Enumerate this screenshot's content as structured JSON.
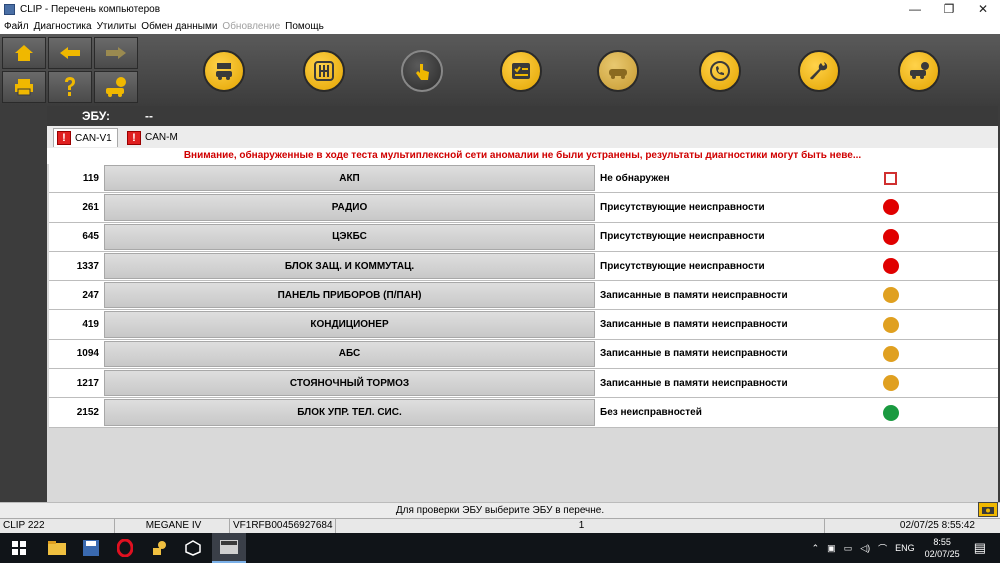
{
  "window": {
    "title": "CLIP - Перечень компьютеров",
    "minimize": "—",
    "restore": "❐",
    "close": "✕"
  },
  "menu": [
    {
      "label": "Файл",
      "disabled": false
    },
    {
      "label": "Диагностика",
      "disabled": false
    },
    {
      "label": "Утилиты",
      "disabled": false
    },
    {
      "label": "Обмен данными",
      "disabled": false
    },
    {
      "label": "Обновление",
      "disabled": true
    },
    {
      "label": "Помощь",
      "disabled": false
    }
  ],
  "toolbar": {
    "nav_icons": [
      "home-icon",
      "back-arrow-icon",
      "forward-arrow-icon",
      "print-icon",
      "help-icon",
      "vehicle-help-icon"
    ],
    "tool_icons": [
      "vehicle-id-icon",
      "gearbox-icon",
      "touch-icon",
      "checklist-icon",
      "car-diagnosis-icon",
      "phone-support-icon",
      "wrench-icon",
      "car-settings-icon"
    ]
  },
  "ecu": {
    "label": "ЭБУ:",
    "value": "--"
  },
  "tabs": [
    {
      "label": "CAN-V1",
      "flag": "!"
    },
    {
      "label": "CAN-M",
      "flag": "!"
    }
  ],
  "warning": "Внимание, обнаруженные в ходе теста мультиплексной сети аномалии не были устранены, результаты диагностики могут быть неве...",
  "rows": [
    {
      "code": "119",
      "name": "АКП",
      "status": "Не обнаружен",
      "indicator": "box"
    },
    {
      "code": "261",
      "name": "РАДИО",
      "status": "Присутствующие неисправности",
      "indicator": "red"
    },
    {
      "code": "645",
      "name": "ЦЭКБС",
      "status": "Присутствующие неисправности",
      "indicator": "red"
    },
    {
      "code": "1337",
      "name": "БЛОК ЗАЩ. И КОММУТАЦ.",
      "status": "Присутствующие неисправности",
      "indicator": "red"
    },
    {
      "code": "247",
      "name": "ПАНЕЛЬ ПРИБОРОВ (П/ПАН)",
      "status": "Записанные в памяти неисправности",
      "indicator": "amber"
    },
    {
      "code": "419",
      "name": "КОНДИЦИОНЕР",
      "status": "Записанные в памяти неисправности",
      "indicator": "amber"
    },
    {
      "code": "1094",
      "name": "АБС",
      "status": "Записанные в памяти неисправности",
      "indicator": "amber"
    },
    {
      "code": "1217",
      "name": "СТОЯНОЧНЫЙ ТОРМОЗ",
      "status": "Записанные в памяти неисправности",
      "indicator": "amber"
    },
    {
      "code": "2152",
      "name": "БЛОК УПР. ТЕЛ. СИС.",
      "status": "Без неисправностей",
      "indicator": "green"
    }
  ],
  "colors": {
    "red": "#e00000",
    "amber": "#e0a020",
    "green": "#1a9a40",
    "accent": "#f0b800"
  },
  "hint": "Для проверки ЭБУ выберите ЭБУ в перечне.",
  "status_bar": {
    "device": "CLIP 222",
    "vehicle": "MEGANE IV",
    "vin": "VF1RFB00456927684",
    "page": "1",
    "datetime": "02/07/25 8:55:42"
  },
  "taskbar": {
    "icons": [
      "windows-start-icon",
      "file-explorer-icon",
      "save-app-icon",
      "opera-icon",
      "help-tool-icon",
      "package-icon",
      "clip-app-icon"
    ],
    "lang": "ENG",
    "time": "8:55",
    "date": "02/07/25"
  }
}
